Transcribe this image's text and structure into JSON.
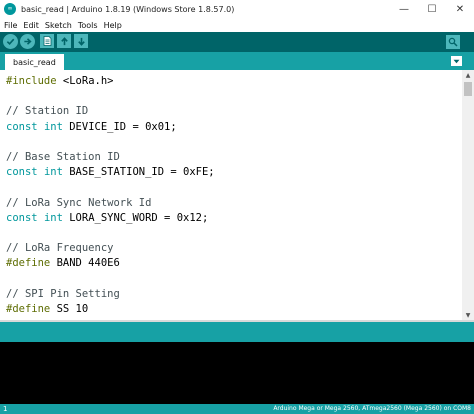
{
  "window": {
    "title": "basic_read | Arduino 1.8.19 (Windows Store 1.8.57.0)",
    "controls": {
      "minimize": "—",
      "maximize": "☐",
      "close": "✕"
    }
  },
  "menu": {
    "items": [
      "File",
      "Edit",
      "Sketch",
      "Tools",
      "Help"
    ]
  },
  "tabs": {
    "active": "basic_read"
  },
  "editor": {
    "lines": [
      [
        {
          "t": "#include ",
          "c": "kw-pp"
        },
        {
          "t": "<LoRa.h>",
          "c": "lit"
        }
      ],
      [],
      [
        {
          "t": "// Station ID",
          "c": "cm"
        }
      ],
      [
        {
          "t": "const ",
          "c": "kw-type"
        },
        {
          "t": "int",
          "c": "kw-type"
        },
        {
          "t": " DEVICE_ID = 0x01;",
          "c": "lit"
        }
      ],
      [],
      [
        {
          "t": "// Base Station ID",
          "c": "cm"
        }
      ],
      [
        {
          "t": "const ",
          "c": "kw-type"
        },
        {
          "t": "int",
          "c": "kw-type"
        },
        {
          "t": " BASE_STATION_ID = 0xFE;",
          "c": "lit"
        }
      ],
      [],
      [
        {
          "t": "// LoRa Sync Network Id",
          "c": "cm"
        }
      ],
      [
        {
          "t": "const ",
          "c": "kw-type"
        },
        {
          "t": "int",
          "c": "kw-type"
        },
        {
          "t": " LORA_SYNC_WORD = 0x12;",
          "c": "lit"
        }
      ],
      [],
      [
        {
          "t": "// LoRa Frequency",
          "c": "cm"
        }
      ],
      [
        {
          "t": "#define ",
          "c": "kw-pp"
        },
        {
          "t": "BAND 440E6",
          "c": "lit"
        }
      ],
      [],
      [
        {
          "t": "// SPI Pin Setting",
          "c": "cm"
        }
      ],
      [
        {
          "t": "#define ",
          "c": "kw-pp"
        },
        {
          "t": "SS 10",
          "c": "lit"
        }
      ]
    ]
  },
  "status": {
    "line_number": "1",
    "board": "Arduino Mega or Mega 2560, ATmega2560 (Mega 2560) on COM8"
  },
  "colors": {
    "toolbar": "#006468",
    "accent": "#17a1a5",
    "button": "#4db7bb",
    "keyword": "#00979c",
    "preprocessor": "#5e6d03",
    "comment": "#434f54"
  }
}
